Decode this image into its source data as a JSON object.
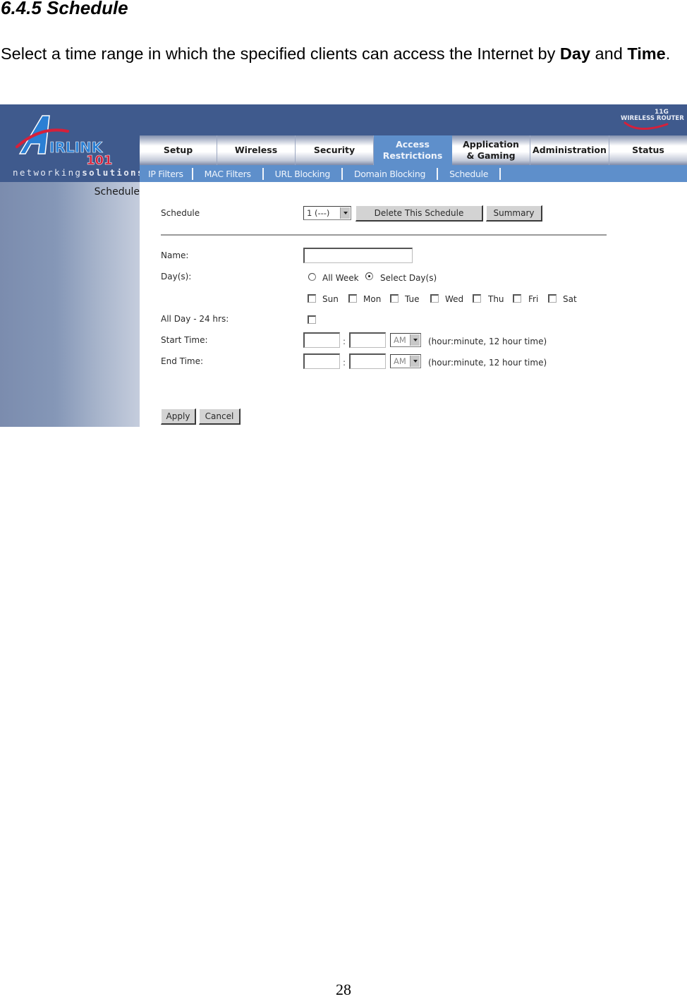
{
  "document": {
    "heading": "6.4.5 Schedule",
    "paragraph_pre": "Select a time range in which the specified clients can access the Internet by ",
    "paragraph_bold1": "Day",
    "paragraph_mid": " and ",
    "paragraph_bold2": "Time",
    "paragraph_post": ".",
    "page_number": "28"
  },
  "router": {
    "logo": {
      "brand": "AIRLINK",
      "brand_suffix": "101",
      "tagline_light": "networking",
      "tagline_bold": "solutions"
    },
    "badge": {
      "line1": "11G",
      "line2": "WIRELESS ROUTER"
    },
    "colors": {
      "header": "#3f5a8d",
      "active_tab": "#5e8fcb",
      "logo_red": "#d6203a",
      "logo_blue": "#2a7fd4"
    },
    "main_tabs": [
      {
        "label": "Setup",
        "active": false
      },
      {
        "label": "Wireless",
        "active": false
      },
      {
        "label": "Security",
        "active": false
      },
      {
        "label": "Access Restrictions",
        "active": true
      },
      {
        "label": "Application & Gaming",
        "active": false
      },
      {
        "label": "Administration",
        "active": false
      },
      {
        "label": "Status",
        "active": false
      }
    ],
    "sub_nav": [
      "IP Filters",
      "MAC Filters",
      "URL Blocking",
      "Domain Blocking",
      "Schedule"
    ],
    "sidebar_title": "Schedule",
    "form": {
      "schedule_label": "Schedule",
      "schedule_select_value": "1 (---)",
      "delete_button": "Delete This Schedule",
      "summary_button": "Summary",
      "name_label": "Name:",
      "name_value": "",
      "days_label": "Day(s):",
      "all_week_label": "All Week",
      "select_days_label": "Select Day(s)",
      "selected_day_mode": "Select Day(s)",
      "days": [
        {
          "label": "Sun",
          "checked": false
        },
        {
          "label": "Mon",
          "checked": false
        },
        {
          "label": "Tue",
          "checked": false
        },
        {
          "label": "Wed",
          "checked": false
        },
        {
          "label": "Thu",
          "checked": false
        },
        {
          "label": "Fri",
          "checked": false
        },
        {
          "label": "Sat",
          "checked": false
        }
      ],
      "all_day_label": "All Day - 24 hrs:",
      "all_day_checked": false,
      "start_time_label": "Start Time:",
      "start_hour": "",
      "start_minute": "",
      "start_ampm": "AM",
      "end_time_label": "End Time:",
      "end_hour": "",
      "end_minute": "",
      "end_ampm": "AM",
      "time_colon": ":",
      "time_hint": "(hour:minute, 12 hour time)",
      "apply_button": "Apply",
      "cancel_button": "Cancel"
    }
  }
}
